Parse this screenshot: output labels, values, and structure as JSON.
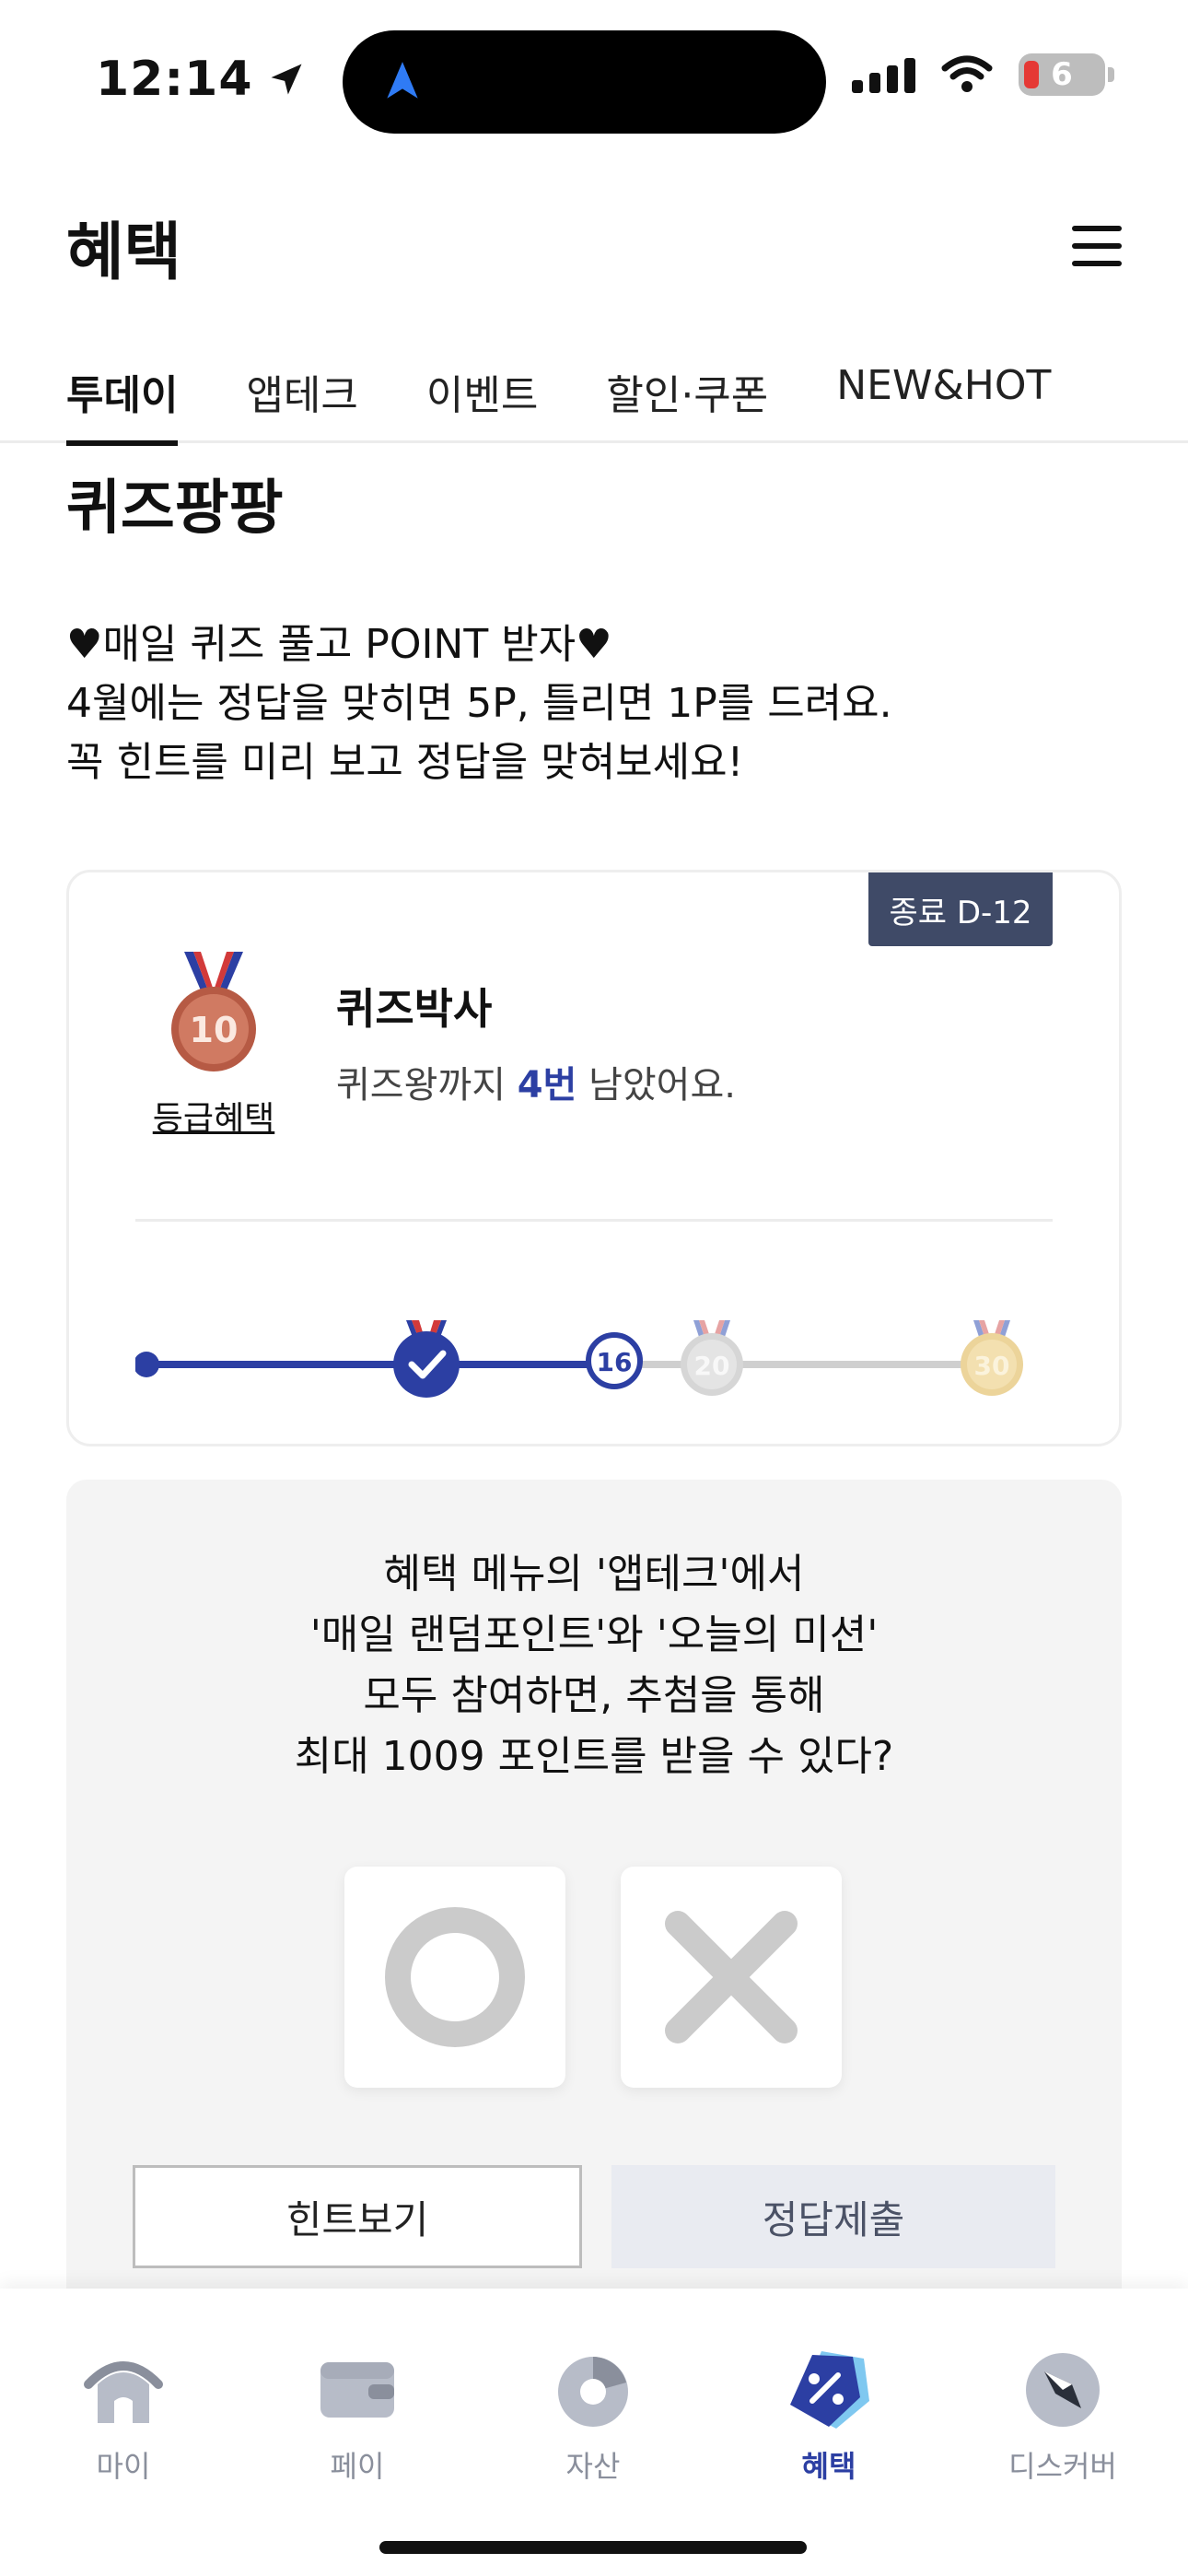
{
  "status_bar": {
    "time": "12:14",
    "battery_level": "6"
  },
  "header": {
    "title": "혜택",
    "menu_icon": "hamburger-icon"
  },
  "tabs": [
    {
      "label": "투데이",
      "active": true
    },
    {
      "label": "앱테크",
      "active": false
    },
    {
      "label": "이벤트",
      "active": false
    },
    {
      "label": "할인·쿠폰",
      "active": false
    },
    {
      "label": "NEW&HOT",
      "active": false
    }
  ],
  "quiz_section": {
    "title": "퀴즈팡팡",
    "intro_lines": [
      "♥매일 퀴즈 풀고 POINT 받자♥",
      "4월에는 정답을 맞히면 5P, 틀리면 1P를 드려요.",
      "꼭 힌트를 미리 보고 정답을 맞혀보세요!"
    ]
  },
  "grade_card": {
    "end_badge": "종료 D-12",
    "medal_number": "10",
    "grade_link": "등급혜택",
    "grade_name": "퀴즈박사",
    "sub_prefix": "퀴즈왕까지 ",
    "sub_highlight": "4번",
    "sub_suffix": " 남았어요.",
    "progress": {
      "current": "16",
      "milestones": [
        "10",
        "20",
        "30"
      ]
    },
    "colors": {
      "accent": "#2c3fa3",
      "bronze": "#c0644c",
      "silver": "#d0d0d0",
      "gold": "#ecd49a"
    }
  },
  "quiz": {
    "question_lines": [
      "혜택 메뉴의 '앱테크'에서",
      "'매일 랜덤포인트'와 '오늘의 미션'",
      "모두 참여하면, 추첨을 통해",
      "최대 1009 포인트를 받을 수 있다?"
    ],
    "hint_label": "힌트보기",
    "submit_label": "정답제출"
  },
  "bottom_nav": [
    {
      "label": "마이",
      "icon": "home-icon",
      "active": false
    },
    {
      "label": "페이",
      "icon": "wallet-icon",
      "active": false
    },
    {
      "label": "자산",
      "icon": "pie-chart-icon",
      "active": false
    },
    {
      "label": "혜택",
      "icon": "discount-tag-icon",
      "active": true
    },
    {
      "label": "디스커버",
      "icon": "compass-icon",
      "active": false
    }
  ]
}
